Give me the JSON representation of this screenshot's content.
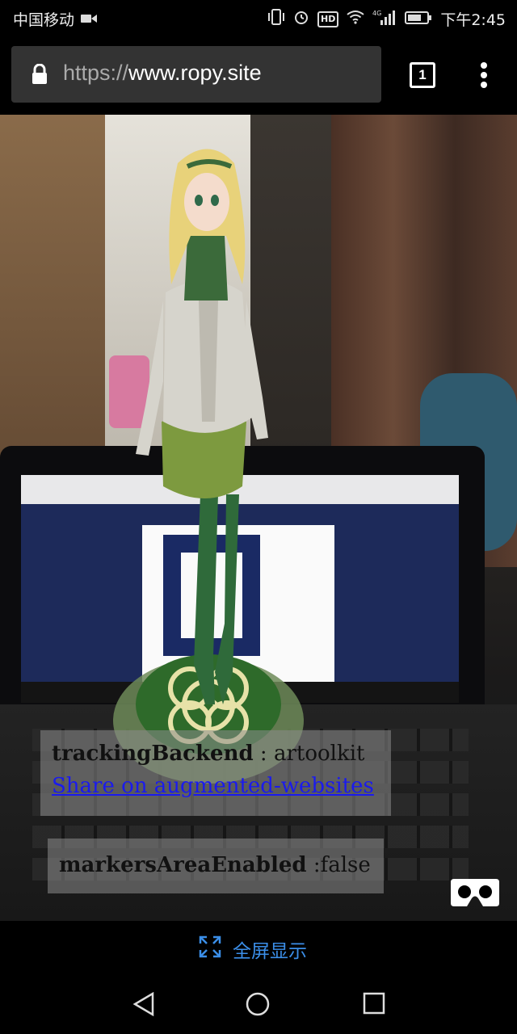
{
  "status_bar": {
    "carrier": "中国移动",
    "time": "下午2:45",
    "hd_label": "HD",
    "network_label": "4G",
    "icons": [
      "video-camera-icon",
      "vibrate-icon",
      "alarm-icon",
      "hd-icon",
      "wifi-icon",
      "signal-icon",
      "battery-icon"
    ]
  },
  "address_bar": {
    "url_scheme": "https://",
    "url_host": "www.ropy.site",
    "tab_count": "1"
  },
  "overlay": {
    "tracking_key": "trackingBackend",
    "tracking_separator": " : ",
    "tracking_value": "artoolkit",
    "share_link": "Share on augmented-websites",
    "markers_key": "markersAreaEnabled",
    "markers_separator": " :",
    "markers_value": "false"
  },
  "fullscreen": {
    "label": "全屏显示"
  },
  "colors": {
    "link": "#1a1aee",
    "fullscreen_accent": "#3b8ee8",
    "panel_bg": "#8c8c8c"
  }
}
